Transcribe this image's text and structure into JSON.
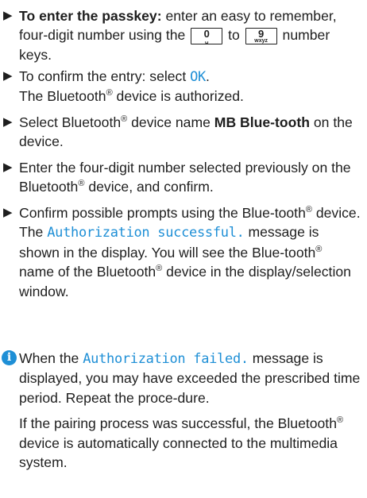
{
  "steps": [
    {
      "bold_lead": "To enter the passkey:",
      "text_a": " enter an easy to remember, four-digit number using the ",
      "key_from": {
        "digit": "0",
        "sub": "␣"
      },
      "text_b": " to ",
      "key_to": {
        "digit": "9",
        "sub": "wxyz"
      },
      "text_c": " number keys."
    },
    {
      "text_a": "To confirm the entry: select ",
      "code": "OK",
      "text_b": ".",
      "result_a": "The Bluetooth",
      "result_sup": "®",
      "result_b": " device is authorized."
    },
    {
      "text_a": "Select Bluetooth",
      "sup": "®",
      "text_b": " device name ",
      "bold": "MB Blue-tooth",
      "text_c": " on the device."
    },
    {
      "text_a": "Enter the four-digit number selected previously on the Bluetooth",
      "sup": "®",
      "text_b": " device, and confirm."
    },
    {
      "text_a": "Confirm possible prompts using the Blue-tooth",
      "sup": "®",
      "text_b": " device.",
      "result_a": "The ",
      "result_code": "Authorization successful.",
      "result_b": " message is shown in the display. You will see the Blue-tooth",
      "result_sup": "®",
      "result_c": " name of the Bluetooth",
      "result_sup2": "®",
      "result_d": " device in the display/selection window."
    }
  ],
  "info": {
    "icon": "info-icon",
    "text_a": "When the ",
    "code": "Authorization failed.",
    "text_b": " message is displayed, you may have exceeded the prescribed time period. Repeat the proce-dure.",
    "para2_a": "If the pairing process was successful, the Bluetooth",
    "para2_sup": "®",
    "para2_b": " device is automatically connected to the multimedia system."
  },
  "colors": {
    "accent": "#1e8fd6",
    "text": "#1e1e1e"
  }
}
